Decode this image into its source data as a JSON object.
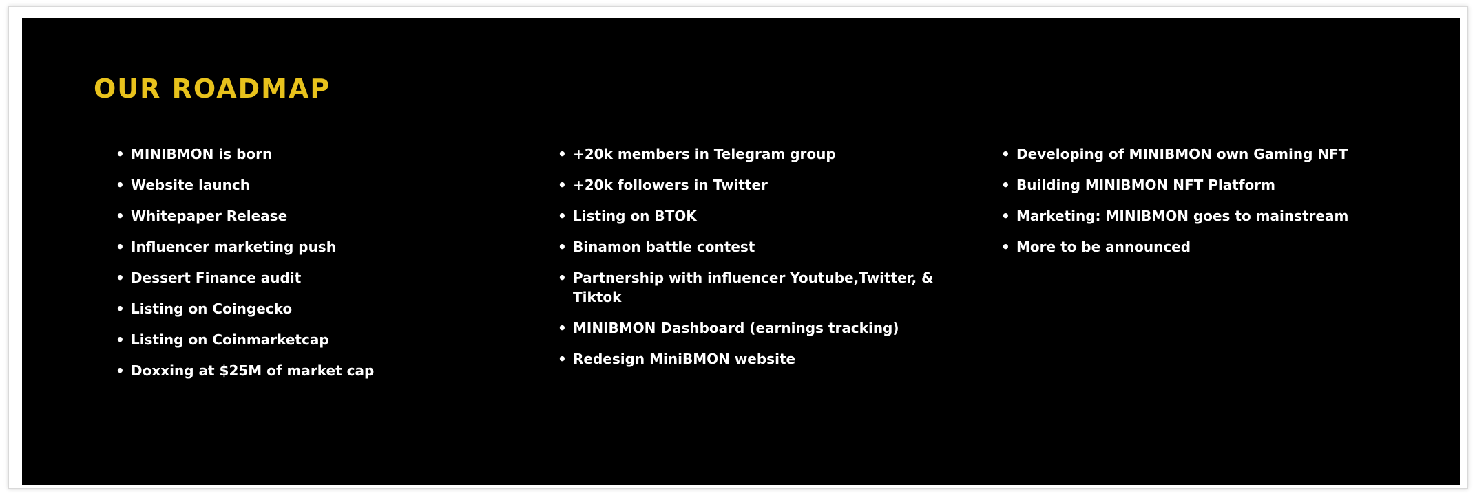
{
  "section": {
    "title": "OUR ROADMAP",
    "title_color": "#e8c21c",
    "background_color": "#000000"
  },
  "columns": [
    {
      "items": [
        " MINIBMON is born",
        "Website launch",
        "Whitepaper Release",
        "Influencer marketing push",
        "Dessert Finance audit",
        "Listing on Coingecko",
        "Listing on Coinmarketcap",
        "Doxxing at $25M of market cap"
      ]
    },
    {
      "items": [
        "+20k members in Telegram group",
        "+20k followers in Twitter",
        "Listing on BTOK",
        "Binamon battle contest",
        "Partnership with influencer Youtube,Twitter, & Tiktok",
        "MINIBMON Dashboard (earnings tracking)",
        "Redesign MiniBMON website"
      ]
    },
    {
      "items": [
        "Developing of MINIBMON own Gaming NFT",
        "Building MINIBMON NFT Platform",
        "Marketing: MINIBMON goes to mainstream",
        "More to be announced"
      ]
    }
  ]
}
